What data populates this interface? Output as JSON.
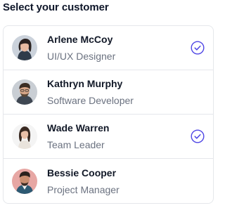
{
  "heading": "Select your customer",
  "colors": {
    "check": "#4f46e5",
    "divider": "#e5e7eb"
  },
  "customers": [
    {
      "name": "Arlene McCoy",
      "role": "UI/UX Designer",
      "selected": true,
      "avatar": "woman-portrait-icon"
    },
    {
      "name": "Kathryn Murphy",
      "role": "Software Developer",
      "selected": false,
      "avatar": "man-portrait-icon"
    },
    {
      "name": "Wade Warren",
      "role": "Team Leader",
      "selected": true,
      "avatar": "woman-portrait-icon"
    },
    {
      "name": "Bessie Cooper",
      "role": "Project Manager",
      "selected": false,
      "avatar": "man-portrait-icon"
    }
  ]
}
